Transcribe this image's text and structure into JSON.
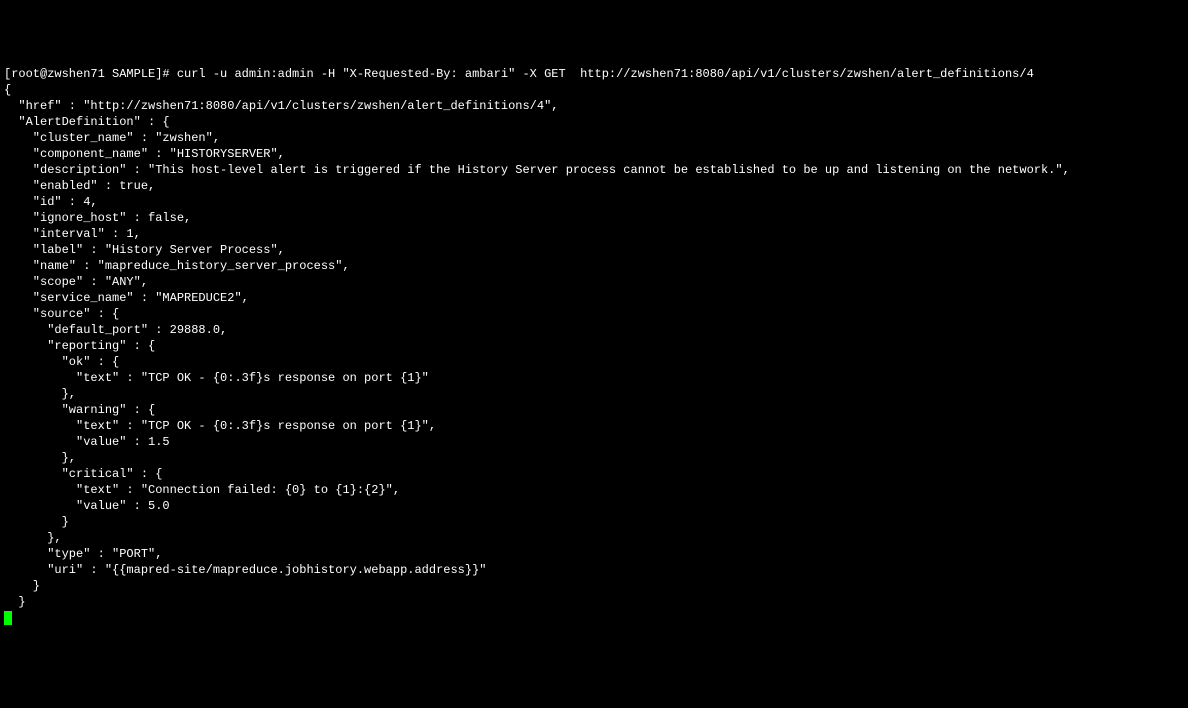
{
  "terminal": {
    "prompt": "[root@zwshen71 SAMPLE]# ",
    "command": "curl -u admin:admin -H \"X-Requested-By: ambari\" -X GET  http://zwshen71:8080/api/v1/clusters/zwshen/alert_definitions/4",
    "lines": [
      "{",
      "  \"href\" : \"http://zwshen71:8080/api/v1/clusters/zwshen/alert_definitions/4\",",
      "  \"AlertDefinition\" : {",
      "    \"cluster_name\" : \"zwshen\",",
      "    \"component_name\" : \"HISTORYSERVER\",",
      "    \"description\" : \"This host-level alert is triggered if the History Server process cannot be established to be up and listening on the network.\",",
      "    \"enabled\" : true,",
      "    \"id\" : 4,",
      "    \"ignore_host\" : false,",
      "    \"interval\" : 1,",
      "    \"label\" : \"History Server Process\",",
      "    \"name\" : \"mapreduce_history_server_process\",",
      "    \"scope\" : \"ANY\",",
      "    \"service_name\" : \"MAPREDUCE2\",",
      "    \"source\" : {",
      "      \"default_port\" : 29888.0,",
      "      \"reporting\" : {",
      "        \"ok\" : {",
      "          \"text\" : \"TCP OK - {0:.3f}s response on port {1}\"",
      "        },",
      "        \"warning\" : {",
      "          \"text\" : \"TCP OK - {0:.3f}s response on port {1}\",",
      "          \"value\" : 1.5",
      "        },",
      "        \"critical\" : {",
      "          \"text\" : \"Connection failed: {0} to {1}:{2}\",",
      "          \"value\" : 5.0",
      "        }",
      "      },",
      "      \"type\" : \"PORT\",",
      "      \"uri\" : \"{{mapred-site/mapreduce.jobhistory.webapp.address}}\"",
      "    }",
      "  }"
    ]
  }
}
